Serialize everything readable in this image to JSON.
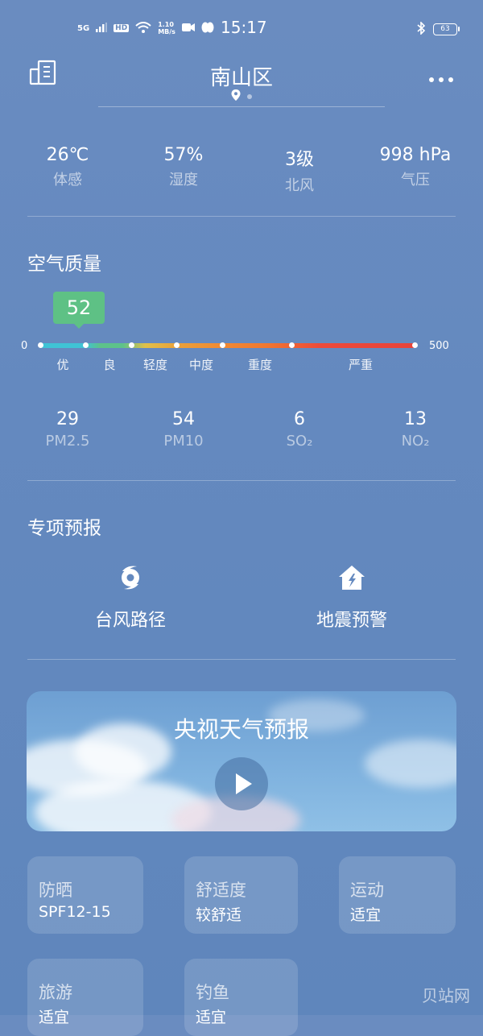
{
  "status_bar": {
    "network": "5G",
    "hd": "HD",
    "speed_value": "1.10",
    "speed_unit": "MB/s",
    "time": "15:17",
    "battery": "63"
  },
  "header": {
    "title": "南山区",
    "city_manage_icon": "city-buildings-icon",
    "more_icon": "more-horizontal-icon"
  },
  "metrics": [
    {
      "value": "26℃",
      "label": "体感"
    },
    {
      "value": "57%",
      "label": "湿度"
    },
    {
      "value": "3级",
      "label": "北风"
    },
    {
      "value": "998 hPa",
      "label": "气压"
    }
  ],
  "air_quality": {
    "title": "空气质量",
    "aqi": "52",
    "aqi_fraction": 0.104,
    "scale_min": "0",
    "scale_max": "500",
    "levels": [
      "优",
      "良",
      "轻度",
      "中度",
      "重度",
      "严重"
    ],
    "pollutants": [
      {
        "value": "29",
        "label": "PM2.5"
      },
      {
        "value": "54",
        "label": "PM10"
      },
      {
        "value": "6",
        "label": "SO₂"
      },
      {
        "value": "13",
        "label": "NO₂"
      }
    ]
  },
  "special_forecast": {
    "title": "专项预报",
    "items": [
      {
        "label": "台风路径",
        "icon": "typhoon-icon"
      },
      {
        "label": "地震预警",
        "icon": "earthquake-house-icon"
      }
    ]
  },
  "video": {
    "title": "央视天气预报",
    "play_icon": "play-icon"
  },
  "cards": [
    {
      "title": "防晒",
      "value": "SPF12-15"
    },
    {
      "title": "舒适度",
      "value": "较舒适"
    },
    {
      "title": "运动",
      "value": "适宜"
    },
    {
      "title": "旅游",
      "value": "适宜"
    },
    {
      "title": "钓鱼",
      "value": "适宜"
    }
  ],
  "watermark": "贝站网",
  "colors": {
    "background": "#6489bf",
    "aqi_good": "#5ec185"
  }
}
